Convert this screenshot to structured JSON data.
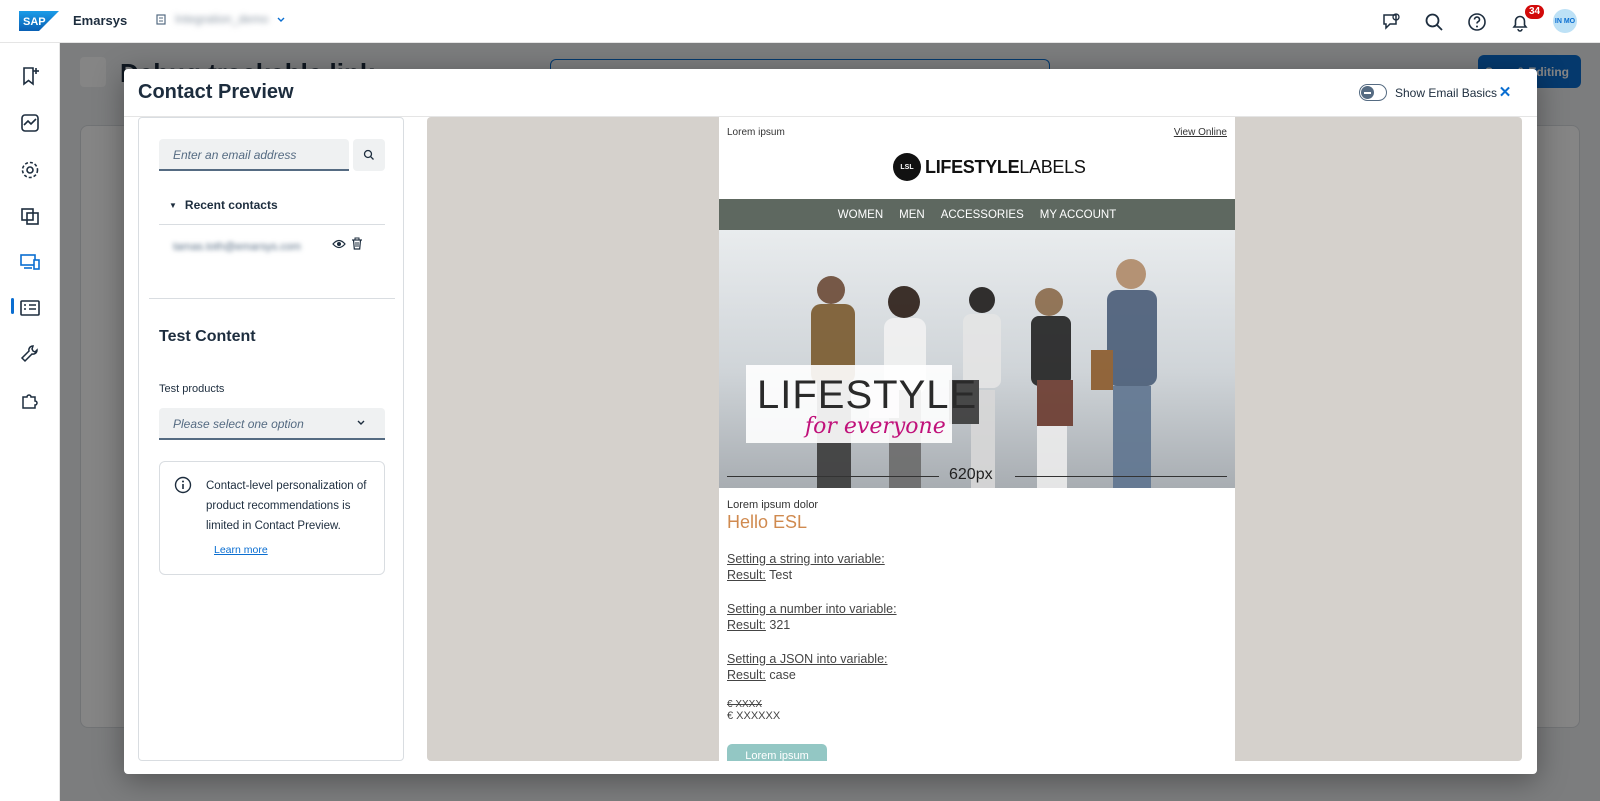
{
  "topbar": {
    "brand": "SAP",
    "app_name": "Emarsys",
    "account_name": "Integration_demo",
    "notifications_count": "34",
    "avatar_initials": "IN MO"
  },
  "background": {
    "page_title": "Debug trackable link",
    "save_label": "Save & Editing"
  },
  "dialog": {
    "title": "Contact Preview",
    "show_basics_label": "Show Email Basics",
    "close_symbol": "✕"
  },
  "left_panel": {
    "email_placeholder": "Enter an email address",
    "recent_label": "Recent contacts",
    "recent_contact": "tamas.toth@emarsys.com",
    "test_content_heading": "Test Content",
    "test_products_label": "Test products",
    "select_placeholder": "Please select one option",
    "info_text": "Contact-level personalization of product recommendations is limited in Contact Preview.",
    "learn_more": "Learn more"
  },
  "email": {
    "preheader": "Lorem ipsum",
    "view_online": "View Online",
    "brand_badge": "LSL",
    "brand_bold": "LIFESTYLE",
    "brand_light": "LABELS",
    "nav": [
      "WOMEN",
      "MEN",
      "ACCESSORIES",
      "MY ACCOUNT"
    ],
    "hero_title": "LIFESTYLE",
    "hero_subtitle": "for everyone",
    "width_label": "620px",
    "intro": "Lorem ipsum dolor",
    "greeting": "Hello ESL",
    "vars": [
      {
        "label": "Setting a string into variable: ",
        "result_label": "Result:",
        "result": " Test"
      },
      {
        "label": "Setting a number into variable:",
        "result_label": "Result:",
        "result": " 321"
      },
      {
        "label": "Setting a JSON into variable:",
        "result_label": "Result:",
        "result": " case"
      }
    ],
    "old_price": "€ XXXX",
    "new_price": "€ XXXXXX",
    "cta": "Lorem ipsum"
  }
}
